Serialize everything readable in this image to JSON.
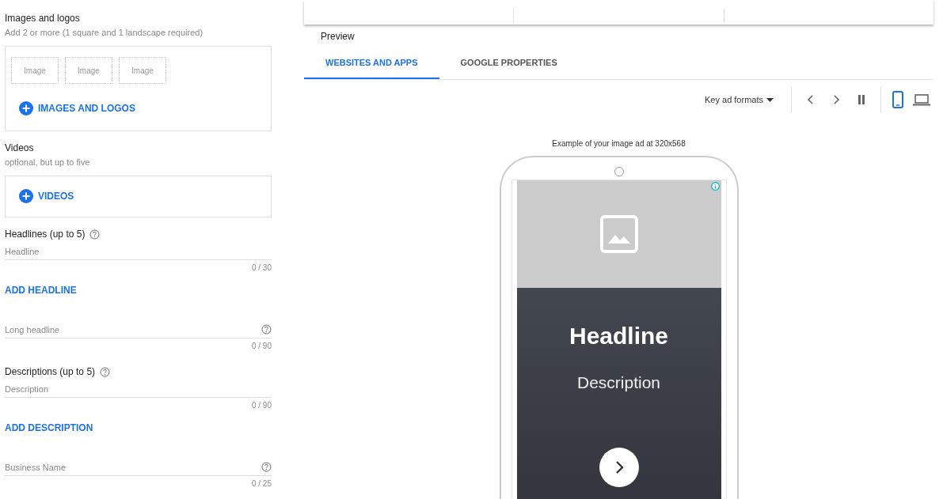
{
  "images_section": {
    "title": "Images and logos",
    "subtitle": "Add 2 or more (1 square and 1 landscape required)",
    "placeholders": [
      "Image",
      "Image",
      "Image"
    ],
    "button": "IMAGES AND LOGOS"
  },
  "videos_section": {
    "title": "Videos",
    "subtitle": "optional, but up to five",
    "button": "VIDEOS"
  },
  "fields": [
    {
      "kind": "group",
      "label": "Headlines (up to 5)",
      "placeholder": "Headline",
      "counter": "0 / 30",
      "add_button": "ADD HEADLINE"
    },
    {
      "kind": "single",
      "placeholder": "Long headline",
      "counter": "0 / 90"
    },
    {
      "kind": "group",
      "label": "Descriptions (up to 5)",
      "placeholder": "Description",
      "counter": "0 / 90",
      "add_button": "ADD DESCRIPTION"
    },
    {
      "kind": "single",
      "placeholder": "Business Name",
      "counter": "0 / 25"
    }
  ],
  "preview": {
    "title": "Preview",
    "tabs": [
      {
        "label": "WEBSITES AND APPS",
        "selected": true
      },
      {
        "label": "GOOGLE PROPERTIES",
        "selected": false
      }
    ],
    "format_dropdown": "Key ad formats",
    "devices": [
      {
        "kind": "phone",
        "selected": true
      },
      {
        "kind": "laptop",
        "selected": false
      }
    ],
    "caption": "Example of your image ad at 320x568",
    "ad": {
      "headline": "Headline",
      "description": "Description"
    }
  }
}
